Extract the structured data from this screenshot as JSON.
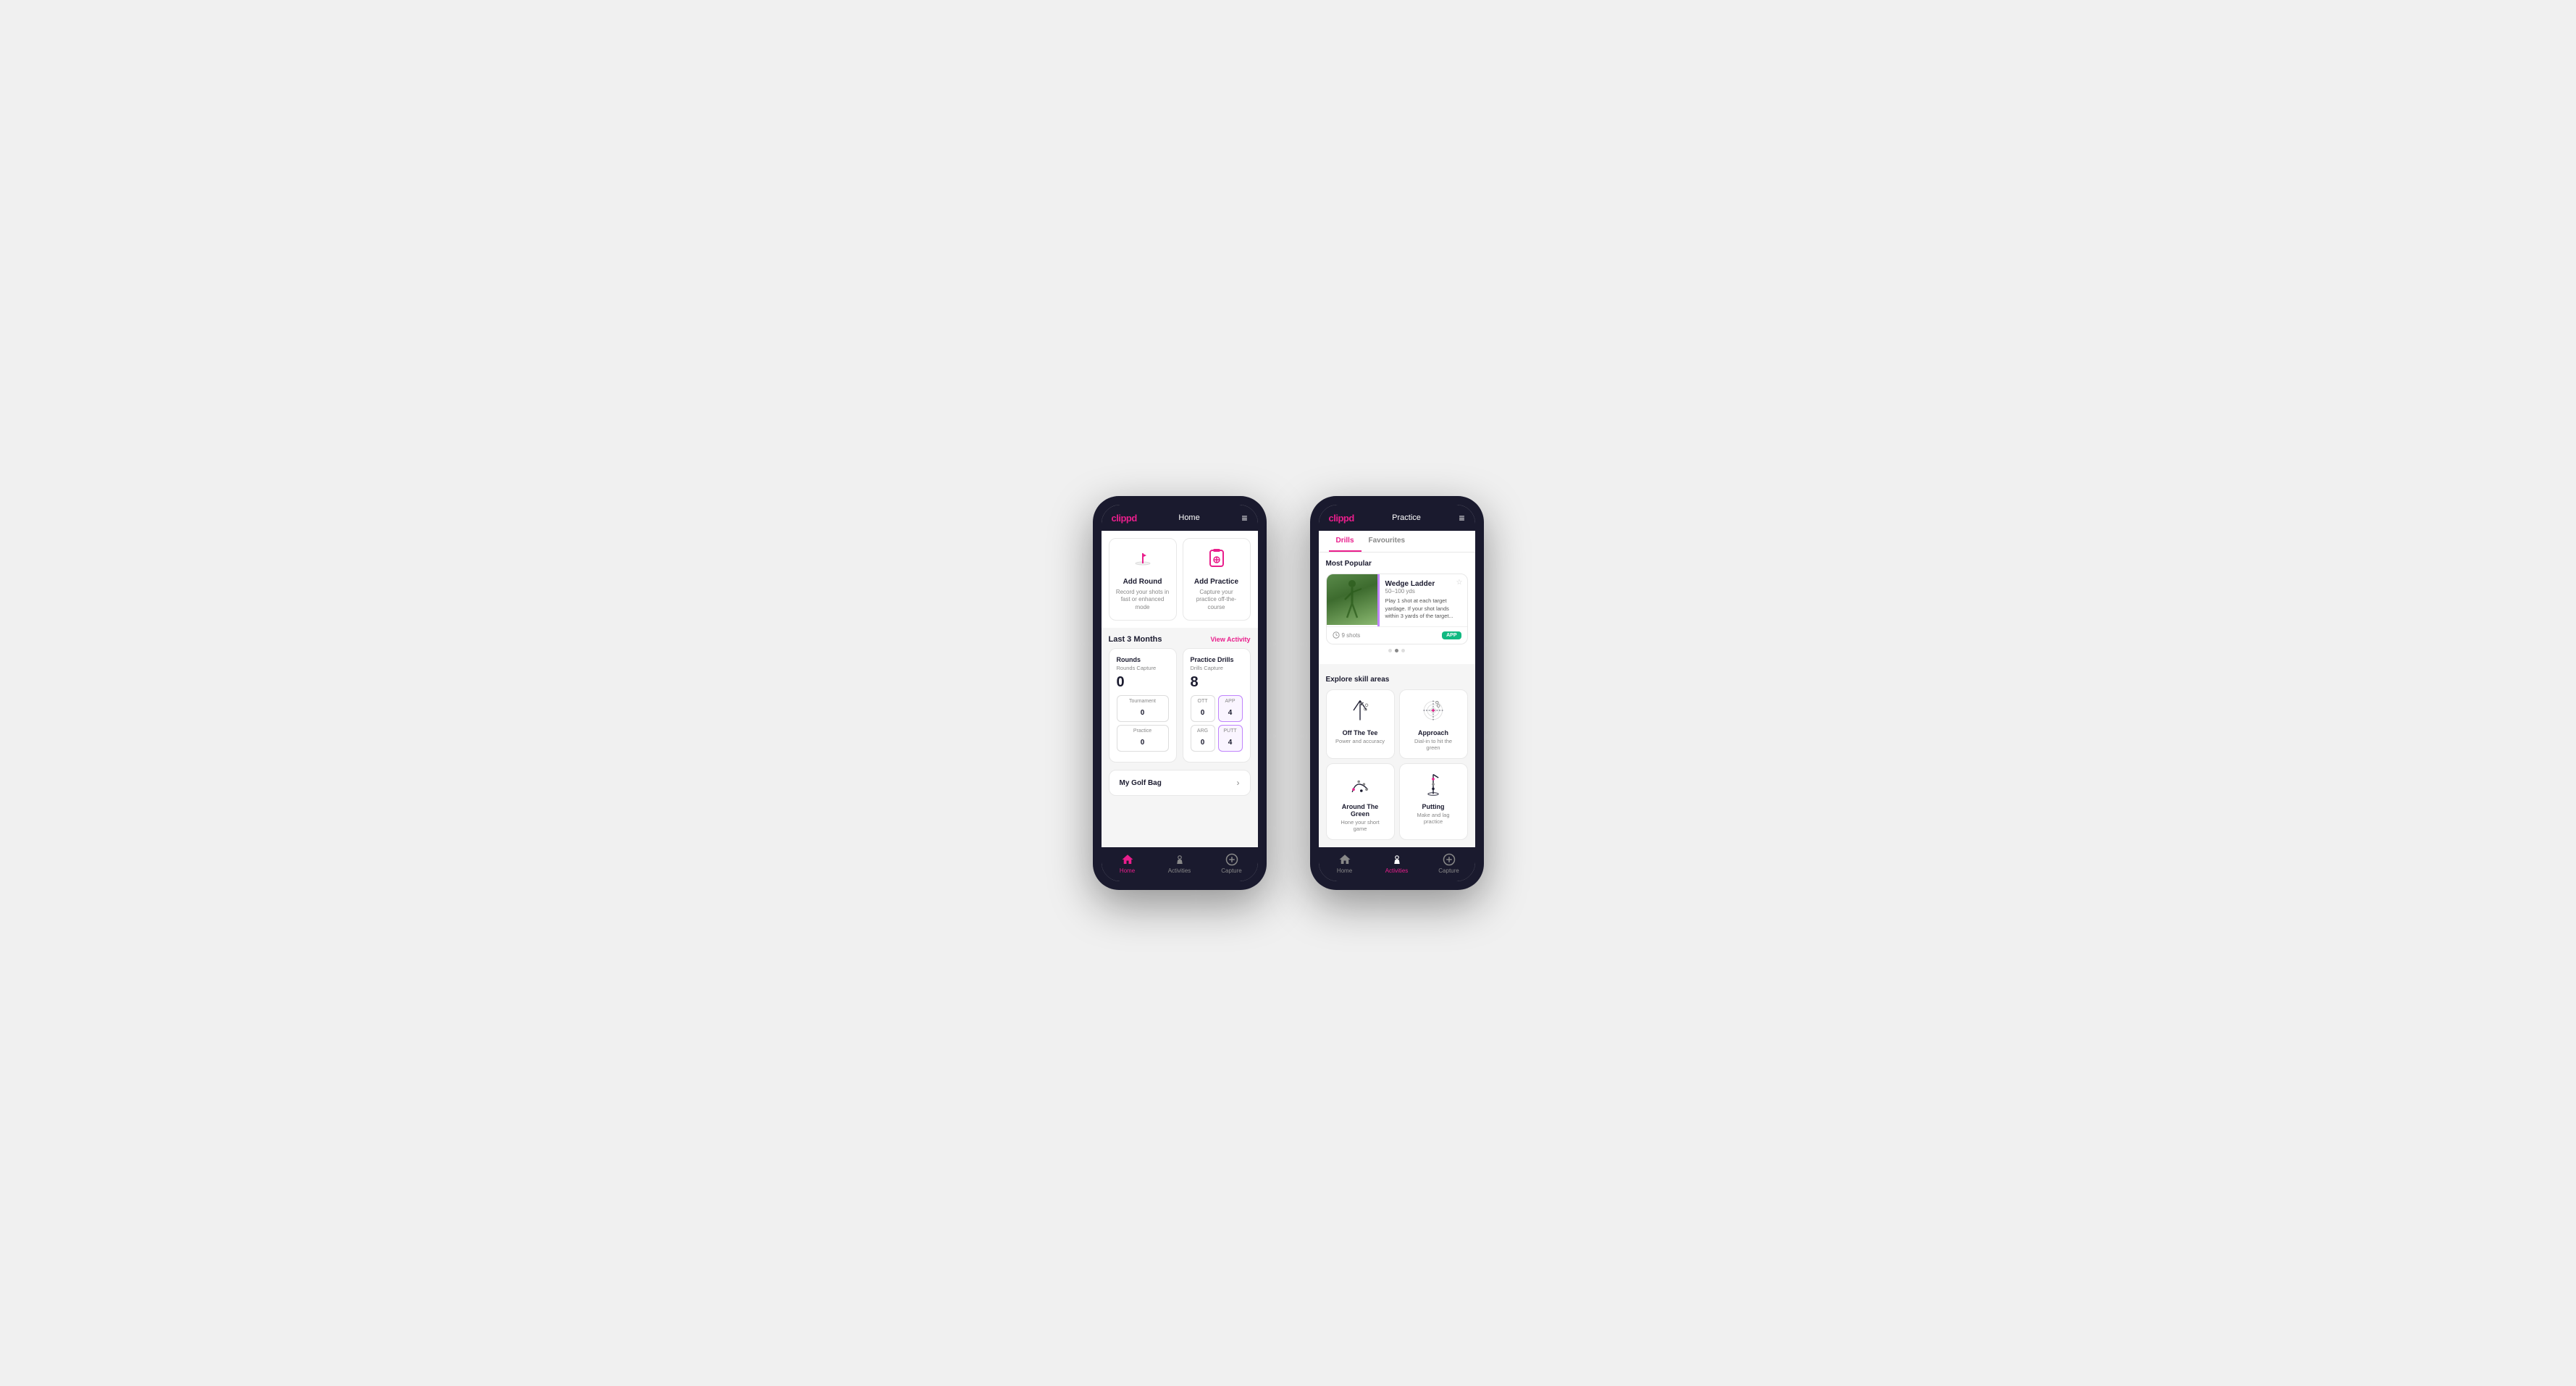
{
  "phone1": {
    "header": {
      "logo": "clippd",
      "title": "Home",
      "menu_icon": "≡"
    },
    "quick_actions": [
      {
        "id": "add-round",
        "icon": "🏌️",
        "title": "Add Round",
        "desc": "Record your shots in fast or enhanced mode"
      },
      {
        "id": "add-practice",
        "icon": "📋",
        "title": "Add Practice",
        "desc": "Capture your practice off-the-course"
      }
    ],
    "last3months": {
      "label": "Last 3 Months",
      "link": "View Activity"
    },
    "rounds": {
      "title": "Rounds",
      "capture_label": "Rounds Capture",
      "total": "0",
      "rows": [
        {
          "label": "Tournament",
          "value": "0"
        },
        {
          "label": "Practice",
          "value": "0"
        }
      ]
    },
    "practice_drills": {
      "title": "Practice Drills",
      "capture_label": "Drills Capture",
      "total": "8",
      "row1": [
        {
          "label": "OTT",
          "value": "0"
        },
        {
          "label": "APP",
          "value": "4",
          "highlight": true
        }
      ],
      "row2": [
        {
          "label": "ARG",
          "value": "0"
        },
        {
          "label": "PUTT",
          "value": "4",
          "highlight": true
        }
      ]
    },
    "my_golf_bag": {
      "title": "My Golf Bag"
    },
    "bottom_nav": [
      {
        "id": "home",
        "icon": "🏠",
        "label": "Home",
        "active": true
      },
      {
        "id": "activities",
        "icon": "⛳",
        "label": "Activities",
        "active": false
      },
      {
        "id": "capture",
        "icon": "➕",
        "label": "Capture",
        "active": false
      }
    ]
  },
  "phone2": {
    "header": {
      "logo": "clippd",
      "title": "Practice",
      "menu_icon": "≡"
    },
    "tabs": [
      {
        "id": "drills",
        "label": "Drills",
        "active": true
      },
      {
        "id": "favourites",
        "label": "Favourites",
        "active": false
      }
    ],
    "most_popular": {
      "title": "Most Popular",
      "drill": {
        "name": "Wedge Ladder",
        "yardage": "50–100 yds",
        "desc": "Play 1 shot at each target yardage. If your shot lands within 3 yards of the target...",
        "shots": "9 shots",
        "badge": "APP"
      },
      "dots": [
        {
          "active": false
        },
        {
          "active": true
        },
        {
          "active": false
        }
      ]
    },
    "explore": {
      "title": "Explore skill areas",
      "skills": [
        {
          "id": "off-the-tee",
          "name": "Off The Tee",
          "desc": "Power and accuracy",
          "icon_type": "tee"
        },
        {
          "id": "approach",
          "name": "Approach",
          "desc": "Dial-in to hit the green",
          "icon_type": "approach"
        },
        {
          "id": "around-the-green",
          "name": "Around The Green",
          "desc": "Hone your short game",
          "icon_type": "atg"
        },
        {
          "id": "putting",
          "name": "Putting",
          "desc": "Make and lag practice",
          "icon_type": "putting"
        }
      ]
    },
    "bottom_nav": [
      {
        "id": "home",
        "icon": "🏠",
        "label": "Home",
        "active": false
      },
      {
        "id": "activities",
        "icon": "⛳",
        "label": "Activities",
        "active": true
      },
      {
        "id": "capture",
        "icon": "➕",
        "label": "Capture",
        "active": false
      }
    ]
  }
}
